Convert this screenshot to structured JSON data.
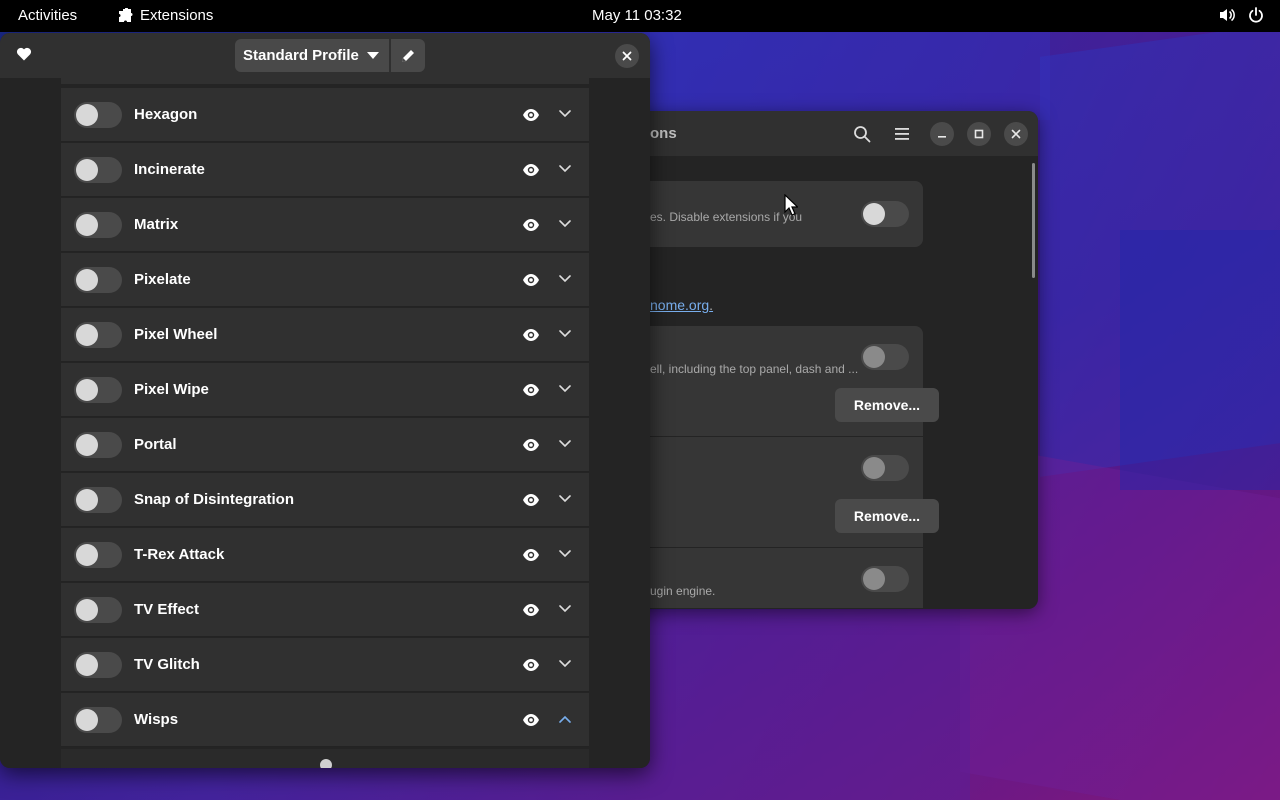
{
  "topbar": {
    "activities": "Activities",
    "app_name": "Extensions",
    "clock": "May 11  03:32"
  },
  "front_window": {
    "profile_label": "Standard Profile",
    "effects": [
      {
        "name": "Hexagon",
        "enabled": false,
        "expanded": false
      },
      {
        "name": "Incinerate",
        "enabled": false,
        "expanded": false
      },
      {
        "name": "Matrix",
        "enabled": false,
        "expanded": false
      },
      {
        "name": "Pixelate",
        "enabled": false,
        "expanded": false
      },
      {
        "name": "Pixel Wheel",
        "enabled": false,
        "expanded": false
      },
      {
        "name": "Pixel Wipe",
        "enabled": false,
        "expanded": false
      },
      {
        "name": "Portal",
        "enabled": false,
        "expanded": false
      },
      {
        "name": "Snap of Disintegration",
        "enabled": false,
        "expanded": false
      },
      {
        "name": "T-Rex Attack",
        "enabled": false,
        "expanded": false
      },
      {
        "name": "TV Effect",
        "enabled": false,
        "expanded": false
      },
      {
        "name": "TV Glitch",
        "enabled": false,
        "expanded": false
      },
      {
        "name": "Wisps",
        "enabled": false,
        "expanded": true
      }
    ]
  },
  "back_window": {
    "title_fragment": "ons",
    "card1_text": "es. Disable extensions if you",
    "link_text": "nome.org",
    "link_suffix": ".",
    "ext1_desc": "ell, including the top panel, dash and ...",
    "remove_label_1": "Remove...",
    "remove_label_2": "Remove...",
    "ext3_desc": "ugin engine."
  },
  "colors": {
    "accent": "#78aeed",
    "window_bg": "#242424",
    "row_bg": "#303030",
    "header_bg": "#303030",
    "button_bg": "#494949"
  }
}
